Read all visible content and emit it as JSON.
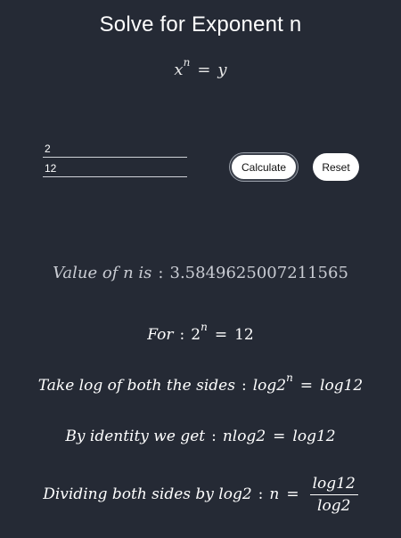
{
  "title": "Solve for Exponent n",
  "formula": {
    "base": "x",
    "exponent": "n",
    "equals": "=",
    "result": "y"
  },
  "inputs": {
    "base_value": "2",
    "result_value": "12"
  },
  "buttons": {
    "calculate": "Calculate",
    "reset": "Reset"
  },
  "answer": {
    "label": "Value of n is",
    "separator": ":",
    "value": "3.5849625007211565"
  },
  "steps": {
    "for": {
      "label": "For",
      "base": "2",
      "exponent": "n",
      "equals": "=",
      "rhs": "12"
    },
    "take_log": {
      "label": "Take log of both the sides",
      "lhs_base": "log2",
      "lhs_exponent": "n",
      "equals": "=",
      "rhs": "log12"
    },
    "identity": {
      "label": "By identity we get",
      "lhs": "nlog2",
      "equals": "=",
      "rhs": "log12"
    },
    "divide": {
      "label": "Dividing both sides by log2",
      "var": "n",
      "equals": "=",
      "numerator": "log12",
      "denominator": "log2"
    }
  }
}
